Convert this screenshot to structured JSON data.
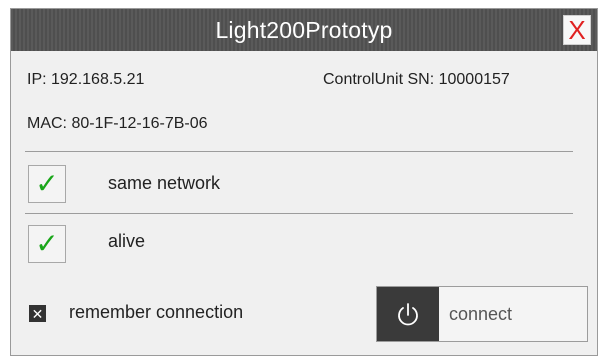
{
  "window": {
    "title": "Light200Prototyp",
    "close_label": "X"
  },
  "info": {
    "ip": "IP: 192.168.5.21",
    "serial": "ControlUnit SN: 10000157",
    "mac": "MAC: 80-1F-12-16-7B-06"
  },
  "checks": {
    "same_network": {
      "label": "same network",
      "checked": true,
      "mark": "✓"
    },
    "alive": {
      "label": "alive",
      "checked": true,
      "mark": "✓"
    }
  },
  "remember": {
    "label": "remember connection",
    "checked": true,
    "mark": "✕"
  },
  "connect_button": {
    "label": "connect",
    "icon": "power-icon"
  },
  "colors": {
    "check_green": "#1aa61a",
    "close_red": "#e02020",
    "titlebar": "#555555"
  }
}
